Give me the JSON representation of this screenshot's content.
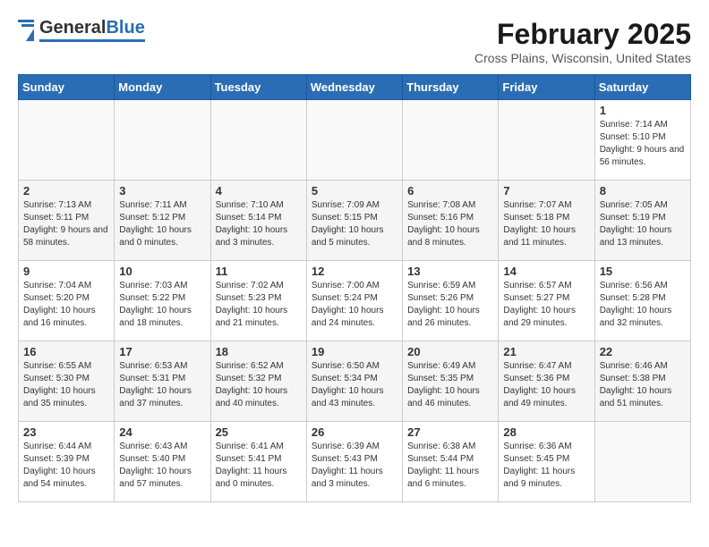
{
  "header": {
    "logo_general": "General",
    "logo_blue": "Blue",
    "month_title": "February 2025",
    "location": "Cross Plains, Wisconsin, United States"
  },
  "days_of_week": [
    "Sunday",
    "Monday",
    "Tuesday",
    "Wednesday",
    "Thursday",
    "Friday",
    "Saturday"
  ],
  "weeks": [
    [
      {
        "day": "",
        "info": ""
      },
      {
        "day": "",
        "info": ""
      },
      {
        "day": "",
        "info": ""
      },
      {
        "day": "",
        "info": ""
      },
      {
        "day": "",
        "info": ""
      },
      {
        "day": "",
        "info": ""
      },
      {
        "day": "1",
        "info": "Sunrise: 7:14 AM\nSunset: 5:10 PM\nDaylight: 9 hours and 56 minutes."
      }
    ],
    [
      {
        "day": "2",
        "info": "Sunrise: 7:13 AM\nSunset: 5:11 PM\nDaylight: 9 hours and 58 minutes."
      },
      {
        "day": "3",
        "info": "Sunrise: 7:11 AM\nSunset: 5:12 PM\nDaylight: 10 hours and 0 minutes."
      },
      {
        "day": "4",
        "info": "Sunrise: 7:10 AM\nSunset: 5:14 PM\nDaylight: 10 hours and 3 minutes."
      },
      {
        "day": "5",
        "info": "Sunrise: 7:09 AM\nSunset: 5:15 PM\nDaylight: 10 hours and 5 minutes."
      },
      {
        "day": "6",
        "info": "Sunrise: 7:08 AM\nSunset: 5:16 PM\nDaylight: 10 hours and 8 minutes."
      },
      {
        "day": "7",
        "info": "Sunrise: 7:07 AM\nSunset: 5:18 PM\nDaylight: 10 hours and 11 minutes."
      },
      {
        "day": "8",
        "info": "Sunrise: 7:05 AM\nSunset: 5:19 PM\nDaylight: 10 hours and 13 minutes."
      }
    ],
    [
      {
        "day": "9",
        "info": "Sunrise: 7:04 AM\nSunset: 5:20 PM\nDaylight: 10 hours and 16 minutes."
      },
      {
        "day": "10",
        "info": "Sunrise: 7:03 AM\nSunset: 5:22 PM\nDaylight: 10 hours and 18 minutes."
      },
      {
        "day": "11",
        "info": "Sunrise: 7:02 AM\nSunset: 5:23 PM\nDaylight: 10 hours and 21 minutes."
      },
      {
        "day": "12",
        "info": "Sunrise: 7:00 AM\nSunset: 5:24 PM\nDaylight: 10 hours and 24 minutes."
      },
      {
        "day": "13",
        "info": "Sunrise: 6:59 AM\nSunset: 5:26 PM\nDaylight: 10 hours and 26 minutes."
      },
      {
        "day": "14",
        "info": "Sunrise: 6:57 AM\nSunset: 5:27 PM\nDaylight: 10 hours and 29 minutes."
      },
      {
        "day": "15",
        "info": "Sunrise: 6:56 AM\nSunset: 5:28 PM\nDaylight: 10 hours and 32 minutes."
      }
    ],
    [
      {
        "day": "16",
        "info": "Sunrise: 6:55 AM\nSunset: 5:30 PM\nDaylight: 10 hours and 35 minutes."
      },
      {
        "day": "17",
        "info": "Sunrise: 6:53 AM\nSunset: 5:31 PM\nDaylight: 10 hours and 37 minutes."
      },
      {
        "day": "18",
        "info": "Sunrise: 6:52 AM\nSunset: 5:32 PM\nDaylight: 10 hours and 40 minutes."
      },
      {
        "day": "19",
        "info": "Sunrise: 6:50 AM\nSunset: 5:34 PM\nDaylight: 10 hours and 43 minutes."
      },
      {
        "day": "20",
        "info": "Sunrise: 6:49 AM\nSunset: 5:35 PM\nDaylight: 10 hours and 46 minutes."
      },
      {
        "day": "21",
        "info": "Sunrise: 6:47 AM\nSunset: 5:36 PM\nDaylight: 10 hours and 49 minutes."
      },
      {
        "day": "22",
        "info": "Sunrise: 6:46 AM\nSunset: 5:38 PM\nDaylight: 10 hours and 51 minutes."
      }
    ],
    [
      {
        "day": "23",
        "info": "Sunrise: 6:44 AM\nSunset: 5:39 PM\nDaylight: 10 hours and 54 minutes."
      },
      {
        "day": "24",
        "info": "Sunrise: 6:43 AM\nSunset: 5:40 PM\nDaylight: 10 hours and 57 minutes."
      },
      {
        "day": "25",
        "info": "Sunrise: 6:41 AM\nSunset: 5:41 PM\nDaylight: 11 hours and 0 minutes."
      },
      {
        "day": "26",
        "info": "Sunrise: 6:39 AM\nSunset: 5:43 PM\nDaylight: 11 hours and 3 minutes."
      },
      {
        "day": "27",
        "info": "Sunrise: 6:38 AM\nSunset: 5:44 PM\nDaylight: 11 hours and 6 minutes."
      },
      {
        "day": "28",
        "info": "Sunrise: 6:36 AM\nSunset: 5:45 PM\nDaylight: 11 hours and 9 minutes."
      },
      {
        "day": "",
        "info": ""
      }
    ]
  ]
}
